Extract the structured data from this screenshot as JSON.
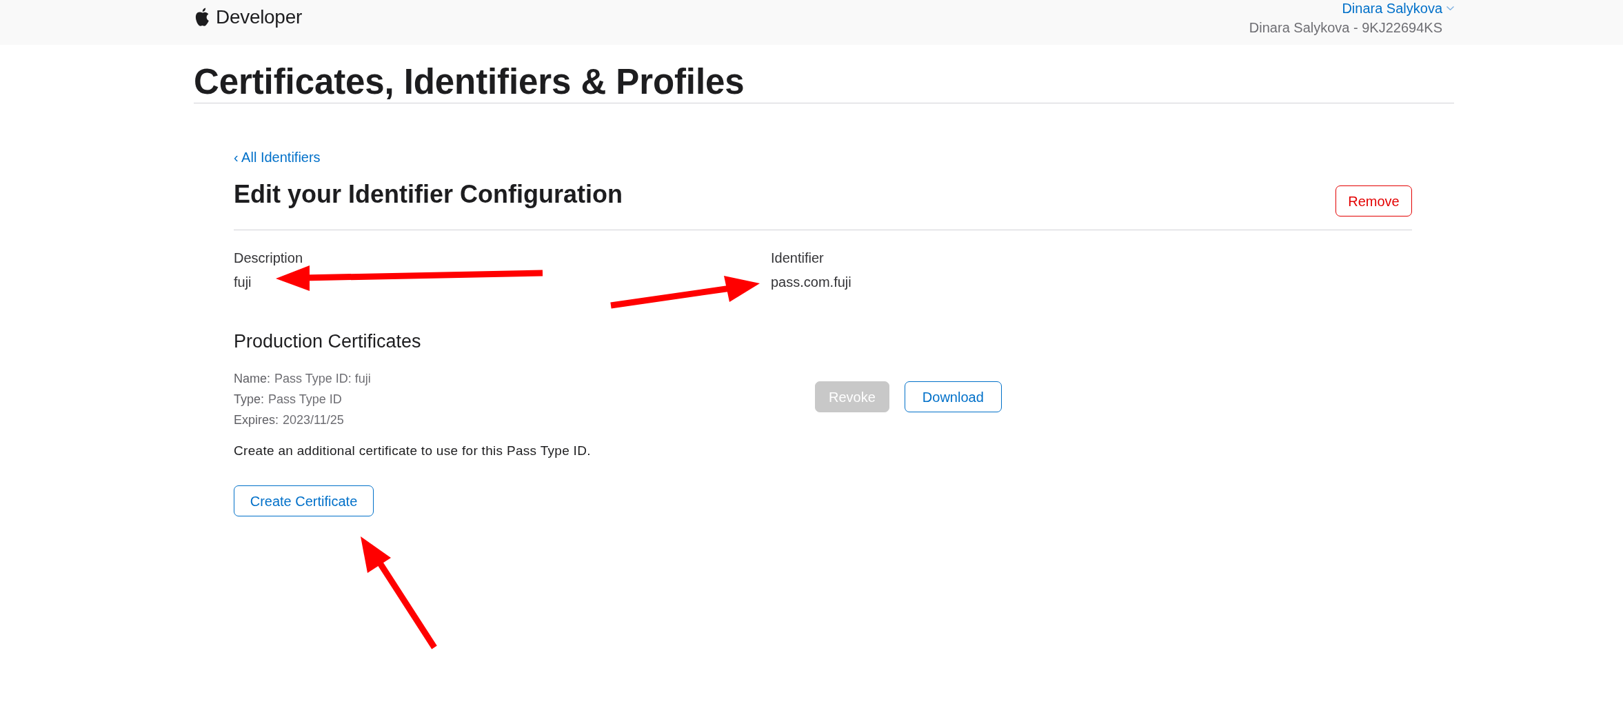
{
  "header": {
    "logo_text": "Developer",
    "account_name": "Dinara Salykova",
    "account_team": "Dinara Salykova - 9KJ22694KS"
  },
  "page_title": "Certificates, Identifiers & Profiles",
  "back_link": "‹ All Identifiers",
  "configuration": {
    "title": "Edit your Identifier Configuration",
    "remove_button": "Remove",
    "fields": [
      {
        "label": "Description",
        "value": "fuji"
      },
      {
        "label": "Identifier",
        "value": "pass.com.fuji"
      }
    ]
  },
  "production_certificates": {
    "title": "Production Certificates",
    "details": [
      {
        "label": "Name:",
        "value": "Pass Type ID: fuji"
      },
      {
        "label": "Type:",
        "value": "Pass Type ID"
      },
      {
        "label": "Expires:",
        "value": "2023/11/25"
      }
    ],
    "actions": [
      {
        "label": "Revoke",
        "disabled": true
      },
      {
        "label": "Download",
        "disabled": false
      }
    ],
    "note": "Create an additional certificate to use for this Pass Type ID.",
    "create_button": "Create Certificate"
  }
}
